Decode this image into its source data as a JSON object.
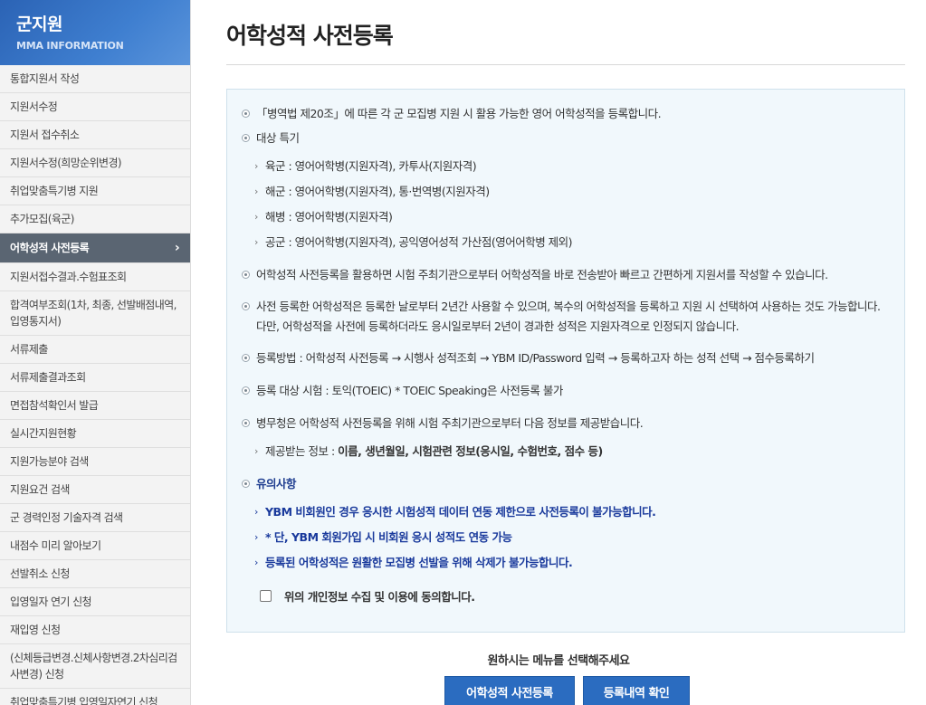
{
  "sidebar": {
    "title": "군지원",
    "subtitle": "MMA INFORMATION",
    "items": [
      {
        "label": "통합지원서 작성"
      },
      {
        "label": "지원서수정"
      },
      {
        "label": "지원서 접수취소"
      },
      {
        "label": "지원서수정(희망순위변경)"
      },
      {
        "label": "취업맞춤특기병 지원"
      },
      {
        "label": "추가모집(육군)"
      },
      {
        "label": "어학성적 사전등록",
        "active": true
      },
      {
        "label": "지원서접수결과.수험표조회"
      },
      {
        "label": "합격여부조회(1차, 최종, 선발배점내역, 입영통지서)"
      },
      {
        "label": "서류제출"
      },
      {
        "label": "서류제출결과조회"
      },
      {
        "label": "면접참석확인서 발급"
      },
      {
        "label": "실시간지원현황"
      },
      {
        "label": "지원가능분야 검색"
      },
      {
        "label": "지원요건 검색"
      },
      {
        "label": "군 경력인정 기술자격 검색"
      },
      {
        "label": "내점수 미리 알아보기"
      },
      {
        "label": "선발취소 신청"
      },
      {
        "label": "입영일자 연기 신청"
      },
      {
        "label": "재입영 신청"
      },
      {
        "label": "(신체등급변경.신체사항변경.2차심리검사변경) 신청"
      },
      {
        "label": "취업맞춤특기병 입영일자연기 신청"
      }
    ],
    "active_chevron": "›"
  },
  "main": {
    "title": "어학성적 사전등록",
    "rows": {
      "r1": "「병역법 제20조」에 따른 각 군 모집병 지원 시 활용 가능한 영어 어학성적을 등록합니다.",
      "r2": "대상 특기",
      "s1": "육군 : 영어어학병(지원자격), 카투사(지원자격)",
      "s2": "해군 : 영어어학병(지원자격), 통·번역병(지원자격)",
      "s3": "해병 : 영어어학병(지원자격)",
      "s4": "공군 : 영어어학병(지원자격), 공익영어성적 가산점(영어어학병 제외)",
      "r3": "어학성적 사전등록을 활용하면 시험 주최기관으로부터 어학성적을 바로 전송받아 빠르고 간편하게 지원서를 작성할 수 있습니다.",
      "r4": "사전 등록한 어학성적은 등록한 날로부터 2년간 사용할 수 있으며, 복수의 어학성적을 등록하고 지원 시 선택하여 사용하는 것도 가능합니다. 다만, 어학성적을 사전에 등록하더라도 응시일로부터 2년이 경과한 성적은 지원자격으로 인정되지 않습니다.",
      "r5": "등록방법 : 어학성적 사전등록 → 시행사 성적조회 → YBM ID/Password 입력 → 등록하고자 하는 성적 선택 → 점수등록하기",
      "r6": "등록 대상 시험 : 토익(TOEIC) * TOEIC Speaking은 사전등록 불가",
      "r7": "병무청은 어학성적 사전등록을 위해 시험 주최기관으로부터 다음 정보를 제공받습니다.",
      "s5_label": "제공받는 정보 : ",
      "s5_value": "이름, 생년월일, 시험관련 정보(응시일, 수험번호, 점수 등)",
      "r8": "유의사항",
      "n1": "YBM 비회원인 경우 응시한 시험성적 데이터 연동 제한으로 사전등록이 불가능합니다.",
      "n2": "* 단, YBM 회원가입 시 비회원 응시 성적도 연동 가능",
      "n3": "등록된 어학성적은 원활한 모집병 선발을 위해 삭제가 불가능합니다."
    },
    "sub_arrow": "›",
    "consent_label": "위의 개인정보 수집 및 이용에 동의합니다.",
    "choose_prompt": "원하시는 메뉴를 선택해주세요",
    "buttons": {
      "register": "어학성적 사전등록",
      "check": "등록내역 확인"
    }
  },
  "colors": {
    "header_blue": "#2b63b5",
    "active_menu": "#5a6572",
    "info_box_bg": "#f1f8fc",
    "note_text": "#1a3a9c",
    "button_blue": "#2b6cc0"
  }
}
